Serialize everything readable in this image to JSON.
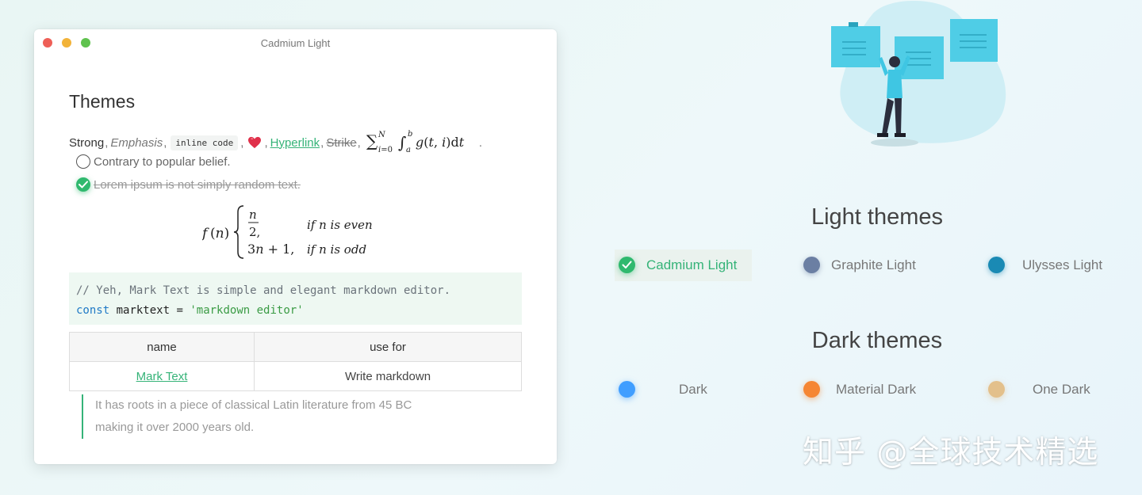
{
  "window": {
    "title": "Cadmium Light",
    "heading": "Themes",
    "inline": {
      "strong": "Strong",
      "emphasis": "Emphasis",
      "code": "inline code",
      "hyperlink": "Hyperlink",
      "strike": "Strike"
    },
    "tasks": [
      {
        "text": "Contrary to popular belief.",
        "checked": false
      },
      {
        "text": "Lorem ipsum is not simply random text.",
        "checked": true
      }
    ],
    "code_block": {
      "comment": "// Yeh, Mark Text is simple and elegant markdown editor.",
      "keyword": "const",
      "var": "marktext",
      "op": "=",
      "string": "'markdown editor'"
    },
    "table": {
      "headers": [
        "name",
        "use for"
      ],
      "rows": [
        [
          "Mark Text",
          "Write markdown"
        ]
      ]
    },
    "blockquote": [
      "It has roots in a piece of classical Latin literature from 45 BC",
      "making it over 2000 years old."
    ]
  },
  "light_themes": {
    "title": "Light themes",
    "items": [
      {
        "name": "Cadmium Light",
        "color": "#2fb96e",
        "selected": true
      },
      {
        "name": "Graphite Light",
        "color": "#6b7fa3",
        "selected": false
      },
      {
        "name": "Ulysses Light",
        "color": "#1a8ab4",
        "selected": false
      }
    ]
  },
  "dark_themes": {
    "title": "Dark themes",
    "items": [
      {
        "name": "Dark",
        "color": "#409eff",
        "selected": false
      },
      {
        "name": "Material Dark",
        "color": "#f58634",
        "selected": false
      },
      {
        "name": "One Dark",
        "color": "#e3c08b",
        "selected": false
      }
    ]
  },
  "watermark": "知乎 @全球技术精选"
}
